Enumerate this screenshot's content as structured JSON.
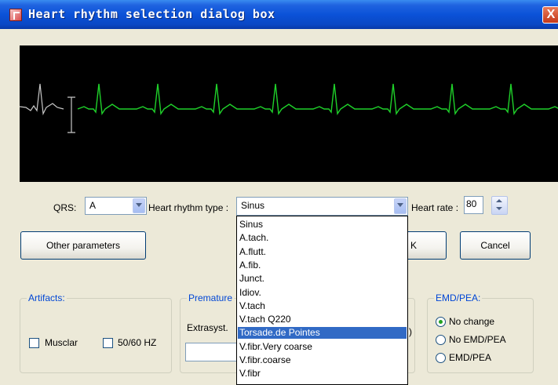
{
  "window": {
    "title": "Heart rhythm selection dialog box",
    "close_glyph": "X"
  },
  "controls": {
    "qrs_label": "QRS:",
    "qrs_value": "A",
    "rhythm_label": "Heart rhythm type :",
    "rhythm_value": "Sinus",
    "rate_label": "Heart rate :",
    "rate_value": "80"
  },
  "buttons": {
    "other_parameters": "Other parameters",
    "ok_partial": "K",
    "cancel": "Cancel"
  },
  "rhythm_options": [
    "Sinus",
    "A.tach.",
    "A.flutt.",
    "A.fib.",
    "Junct.",
    "Idiov.",
    "V.tach",
    "V.tach Q220",
    "Torsade.de Pointes",
    "V.fibr.Very coarse",
    "V.fibr.coarse",
    "V.fibr"
  ],
  "selected_option_index": 8,
  "groups": {
    "artifacts": {
      "title": "Artifacts:",
      "muscular_label": "Musclаr",
      "hz_label": "50/60 HZ"
    },
    "premature": {
      "title": "Premature",
      "extrasyst_label": "Extrasyst.",
      "partial_text": ")"
    },
    "emd_pea": {
      "title": "EMD/PEA:",
      "options": [
        "No change",
        "No EMD/PEA",
        "EMD/PEA"
      ],
      "selected": 0
    }
  },
  "colors": {
    "titlebar": "#0b52d8",
    "monitor_bg": "#000000",
    "ecg_trace": "#1fd12a",
    "ecg_reference": "#c8c8c8",
    "group_title": "#0046d5",
    "selection": "#316ac5"
  },
  "icons": {
    "title": "heart-app-icon",
    "close": "close-icon",
    "combo": "chevron-down-icon",
    "spin": "spin-arrows-icon"
  }
}
